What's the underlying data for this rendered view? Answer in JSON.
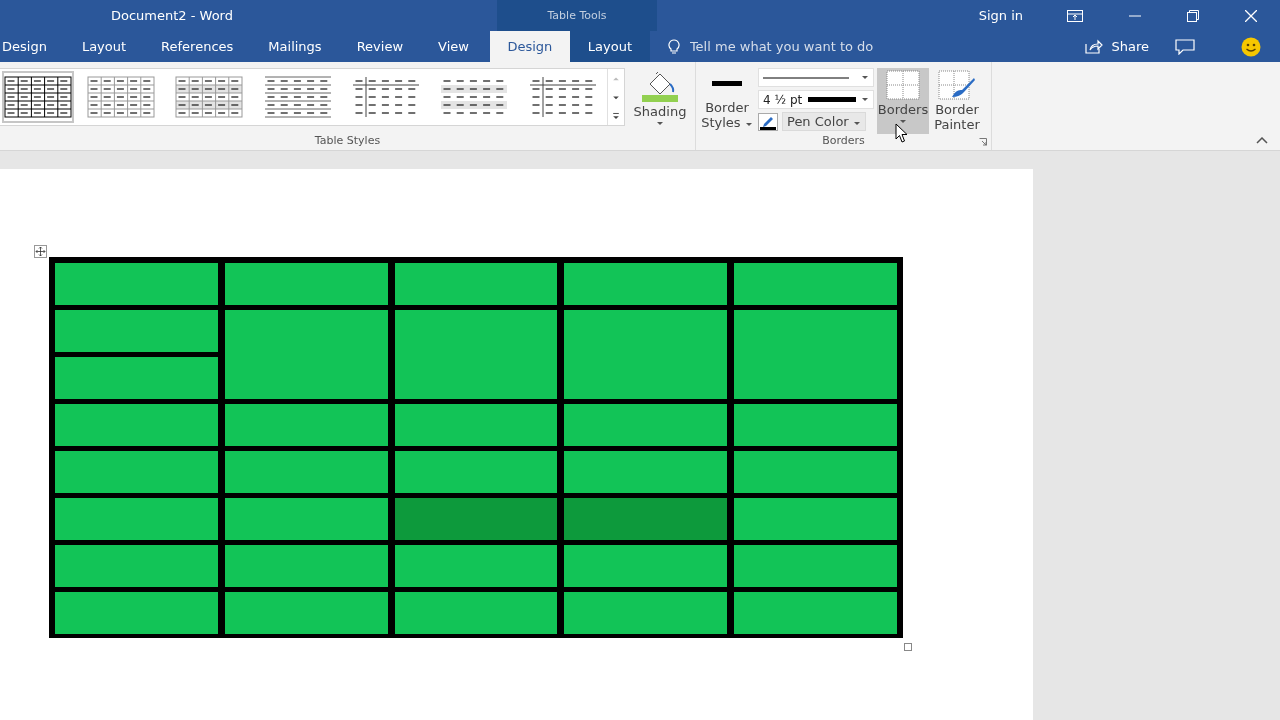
{
  "window": {
    "title": "Document2  -  Word",
    "contextual_label": "Table Tools",
    "sign_in": "Sign in"
  },
  "tabs": [
    {
      "label": "Design",
      "selected": false,
      "kind": "main"
    },
    {
      "label": "Layout",
      "selected": false,
      "kind": "main"
    },
    {
      "label": "References",
      "selected": false,
      "kind": "main"
    },
    {
      "label": "Mailings",
      "selected": false,
      "kind": "main"
    },
    {
      "label": "Review",
      "selected": false,
      "kind": "main"
    },
    {
      "label": "View",
      "selected": false,
      "kind": "main"
    },
    {
      "label": "Design",
      "selected": true,
      "kind": "contextual"
    },
    {
      "label": "Layout",
      "selected": false,
      "kind": "contextual"
    }
  ],
  "tell_me": {
    "placeholder": "Tell me what you want to do"
  },
  "share": "Share",
  "table_styles": {
    "label": "Table Styles",
    "styles": [
      {
        "kind": "grid-bold",
        "selected": true
      },
      {
        "kind": "grid",
        "selected": false
      },
      {
        "kind": "grid-shaded",
        "selected": false
      },
      {
        "kind": "lines",
        "selected": false
      },
      {
        "kind": "header-col",
        "selected": false
      },
      {
        "kind": "plain",
        "selected": false
      },
      {
        "kind": "header-col",
        "selected": false
      }
    ]
  },
  "shading": {
    "label": "Shading"
  },
  "borders_group": {
    "label": "Borders",
    "border_styles": "Border Styles",
    "pen_weight": "4 ½ pt",
    "pen_color": "Pen Color",
    "borders": "Borders",
    "borders_hovered": true,
    "border_painter": "Border Painter"
  },
  "table": {
    "rows": [
      {
        "kind": "normal",
        "cells": [
          {
            "kind": "single",
            "selected": false
          },
          {
            "kind": "single",
            "selected": false
          },
          {
            "kind": "single",
            "selected": false
          },
          {
            "kind": "single",
            "selected": false
          },
          {
            "kind": "single",
            "selected": false
          }
        ]
      },
      {
        "kind": "tall",
        "cells": [
          {
            "kind": "split",
            "selected": false
          },
          {
            "kind": "single",
            "selected": false
          },
          {
            "kind": "single",
            "selected": false
          },
          {
            "kind": "single",
            "selected": false
          },
          {
            "kind": "single",
            "selected": false
          }
        ]
      },
      {
        "kind": "normal",
        "cells": [
          {
            "kind": "single",
            "selected": false
          },
          {
            "kind": "single",
            "selected": false
          },
          {
            "kind": "single",
            "selected": false
          },
          {
            "kind": "single",
            "selected": false
          },
          {
            "kind": "single",
            "selected": false
          }
        ]
      },
      {
        "kind": "normal",
        "cells": [
          {
            "kind": "single",
            "selected": false
          },
          {
            "kind": "single",
            "selected": false
          },
          {
            "kind": "single",
            "selected": false
          },
          {
            "kind": "single",
            "selected": false
          },
          {
            "kind": "single",
            "selected": false
          }
        ]
      },
      {
        "kind": "normal",
        "cells": [
          {
            "kind": "single",
            "selected": false
          },
          {
            "kind": "single",
            "selected": false
          },
          {
            "kind": "single",
            "selected": true
          },
          {
            "kind": "single",
            "selected": true
          },
          {
            "kind": "single",
            "selected": false
          }
        ]
      },
      {
        "kind": "normal",
        "cells": [
          {
            "kind": "single",
            "selected": false
          },
          {
            "kind": "single",
            "selected": false
          },
          {
            "kind": "single",
            "selected": false
          },
          {
            "kind": "single",
            "selected": false
          },
          {
            "kind": "single",
            "selected": false
          }
        ]
      },
      {
        "kind": "normal",
        "cells": [
          {
            "kind": "single",
            "selected": false
          },
          {
            "kind": "single",
            "selected": false
          },
          {
            "kind": "single",
            "selected": false
          },
          {
            "kind": "single",
            "selected": false
          },
          {
            "kind": "single",
            "selected": false
          }
        ]
      }
    ]
  }
}
